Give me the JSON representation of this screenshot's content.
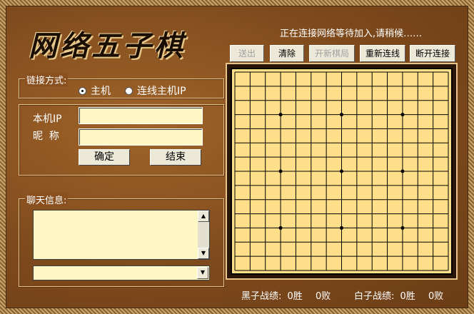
{
  "app_title": "网络五子棋",
  "status": "正在连接网络等待加入,请稍候……",
  "toolbar": {
    "send": "送出",
    "clear": "清除",
    "start": "开新棋局",
    "reconnect": "重新连线",
    "disconnect": "断开连接"
  },
  "connection": {
    "legend": "链接方式:",
    "host": "主机",
    "client": "连线主机IP",
    "selected": "host"
  },
  "form": {
    "ip_label": "本机IP",
    "ip_value": "",
    "nick_label": "昵  称",
    "nick_value": "",
    "confirm": "确定",
    "end": "结束"
  },
  "chat": {
    "legend": "聊天信息:",
    "messages": "",
    "input": ""
  },
  "board": {
    "lines": 15,
    "star_points": [
      [
        3,
        3
      ],
      [
        7,
        3
      ],
      [
        11,
        3
      ],
      [
        3,
        7
      ],
      [
        7,
        7
      ],
      [
        11,
        7
      ],
      [
        3,
        11
      ],
      [
        7,
        11
      ],
      [
        11,
        11
      ]
    ]
  },
  "score": {
    "black_label": "黑子战绩:",
    "black_win": "0胜",
    "black_loss": "0败",
    "white_label": "白子战绩:",
    "white_win": "0胜",
    "white_loss": "0败"
  },
  "colors": {
    "board": "#ffdf8a",
    "panel": "#7e4a1c",
    "input": "#fff7c4"
  }
}
